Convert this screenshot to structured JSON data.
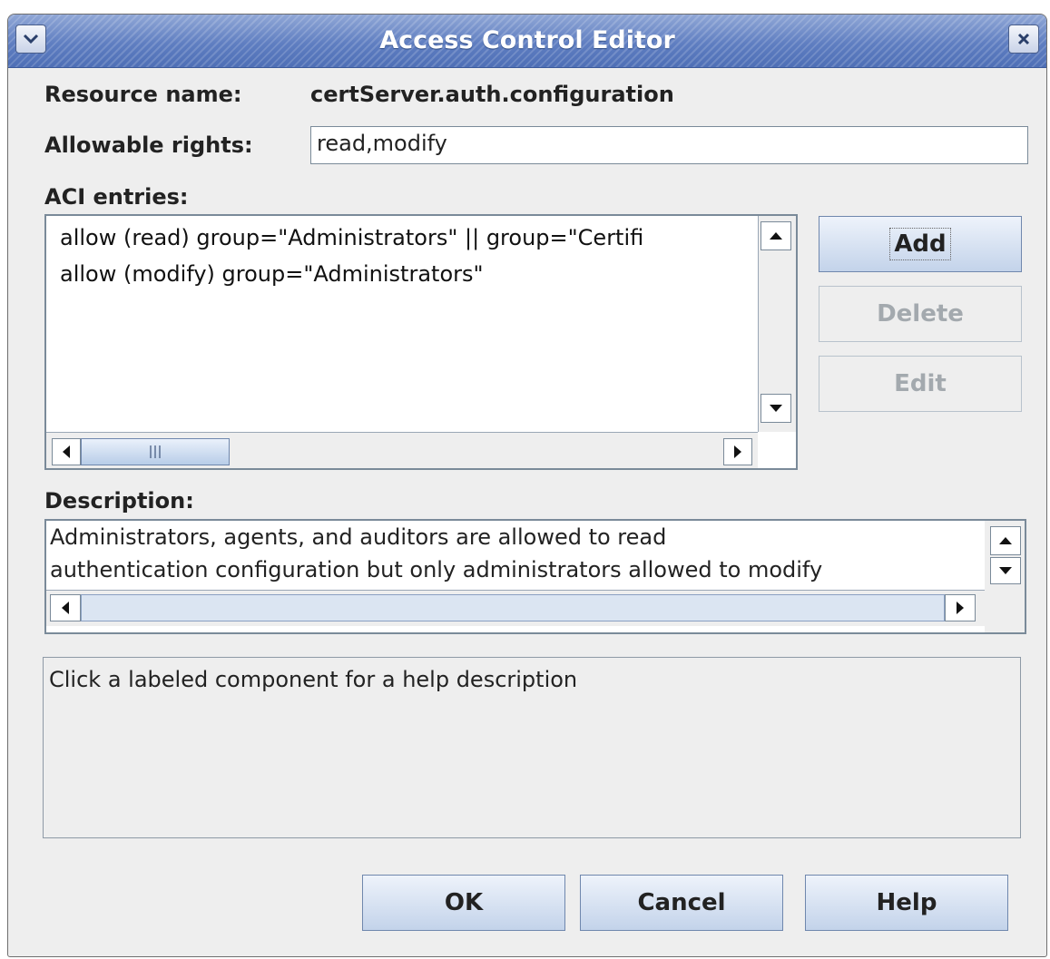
{
  "window": {
    "title": "Access Control Editor"
  },
  "resource": {
    "label": "Resource name:",
    "value": "certServer.auth.configuration"
  },
  "rights": {
    "label": "Allowable rights:",
    "value": "read,modify"
  },
  "aci": {
    "label": "ACI entries:",
    "entries": [
      "allow (read) group=\"Administrators\" || group=\"Certifi",
      "allow (modify) group=\"Administrators\""
    ]
  },
  "side_buttons": {
    "add": "Add",
    "delete": "Delete",
    "edit": "Edit"
  },
  "description": {
    "label": "Description:",
    "lines": [
      "Administrators, agents, and auditors are allowed to read",
      "authentication configuration but only administrators allowed to modify"
    ]
  },
  "help": {
    "text": "Click a labeled component for a help description"
  },
  "bottom_buttons": {
    "ok": "OK",
    "cancel": "Cancel",
    "help": "Help"
  }
}
